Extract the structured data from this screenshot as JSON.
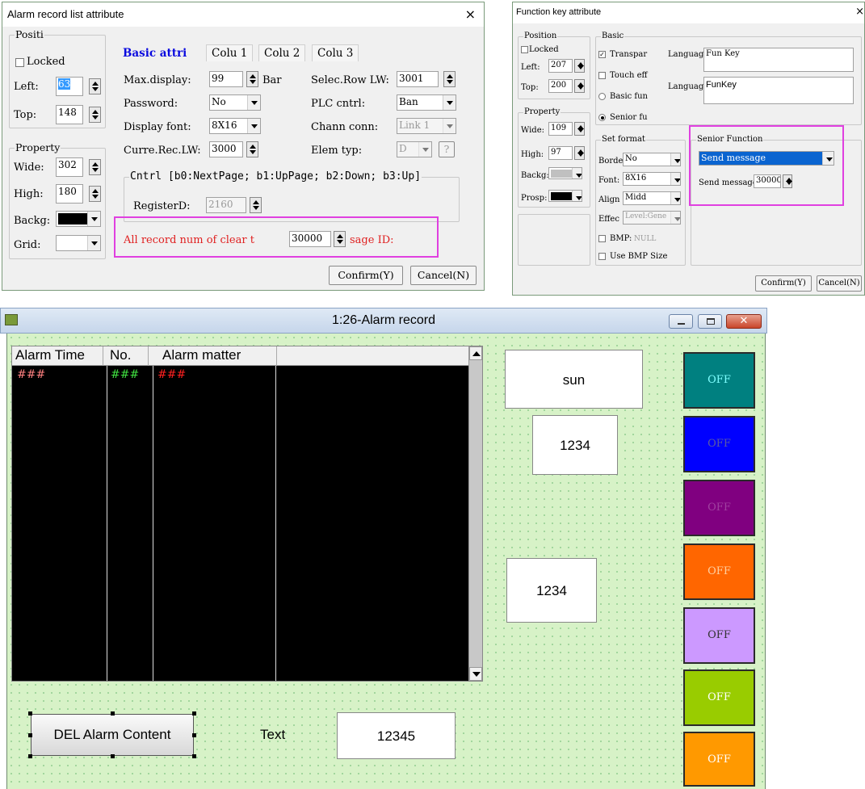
{
  "alarm_dialog": {
    "title": "Alarm record list attribute",
    "close": "×",
    "position": {
      "legend": "Positi",
      "locked": "Locked",
      "left_label": "Left:",
      "left_value": "63",
      "top_label": "Top:",
      "top_value": "148"
    },
    "property": {
      "legend": "Property",
      "wide_label": "Wide:",
      "wide_value": "302",
      "high_label": "High:",
      "high_value": "180",
      "backg_label": "Backg:",
      "backg_color": "#000000",
      "grid_label": "Grid:",
      "grid_color": "#ffffff"
    },
    "tabs": [
      "Basic attri",
      "Colu 1",
      "Colu 2",
      "Colu 3"
    ],
    "fields": {
      "max_display_label": "Max.display:",
      "max_display_value": "99",
      "bar_label": "Bar",
      "password_label": "Password:",
      "password_value": "No",
      "display_font_label": "Display font:",
      "display_font_value": "8X16",
      "curre_rec_label": "Curre.Rec.LW:",
      "curre_rec_value": "3000",
      "selec_row_label": "Selec.Row LW:",
      "selec_row_value": "3001",
      "plc_cntrl_label": "PLC cntrl:",
      "plc_cntrl_value": "Ban",
      "chann_conn_label": "Chann conn:",
      "chann_conn_value": "Link 1",
      "elem_typ_label": "Elem typ:",
      "elem_typ_value": "D",
      "elem_typ_btn": "?"
    },
    "cntrl": {
      "legend": "Cntrl [b0:NextPage; b1:UpPage; b2:Down; b3:Up]",
      "register_label": "RegisterD:",
      "register_value": "2160"
    },
    "clear": {
      "label_pre": "All record num of clear t",
      "value": "30000",
      "label_post": "sage ID:"
    },
    "confirm": "Confirm(Y)",
    "cancel": "Cancel(N)"
  },
  "func_dialog": {
    "title": "Function key attribute",
    "close": "×",
    "position": {
      "legend": "Position",
      "locked": "Locked",
      "left_label": "Left:",
      "left_value": "207",
      "top_label": "Top:",
      "top_value": "200"
    },
    "property": {
      "legend": "Property",
      "wide_label": "Wide:",
      "wide_value": "109",
      "high_label": "High:",
      "high_value": "97",
      "backg_label": "Backg:",
      "backg_color": "#c0c0c0",
      "prosp_label": "Prosp:",
      "prosp_color": "#000000"
    },
    "basic": {
      "legend": "Basic",
      "transpar": "Transpar",
      "touch_eff": "Touch eff",
      "basic_fun": "Basic fun",
      "senior_fun": "Senior fu",
      "language_label": "Languag",
      "language1_value": "Fun Key",
      "language2_label": "Languag",
      "language2_value": "FunKey"
    },
    "format": {
      "legend": "Set format",
      "border_label": "Borde",
      "border_value": "No",
      "font_label": "Font:",
      "font_value": "8X16",
      "align_label": "Align",
      "align_value": "Midd",
      "effect_label": "Effec",
      "effect_value": "Level:Gene",
      "bmp_label": "BMP:",
      "bmp_value": "NULL",
      "use_bmp": "Use BMP Size"
    },
    "senior": {
      "legend": "Senior Function",
      "selected": "Send message",
      "msg_label": "Send message",
      "msg_value": "30000"
    },
    "confirm": "Confirm(Y)",
    "cancel": "Cancel(N)"
  },
  "preview": {
    "title": "1:26-Alarm record",
    "table_headers": [
      "Alarm Time",
      "No.",
      "Alarm matter"
    ],
    "row": [
      "###",
      "###",
      "###"
    ],
    "boxes": {
      "sun": "sun",
      "num1": "1234",
      "num2": "1234",
      "num3": "12345"
    },
    "text_label": "Text",
    "del_button": "DEL Alarm Content",
    "tiles": [
      {
        "label": "OFF",
        "color": "#008080"
      },
      {
        "label": "OFF",
        "color": "#0000ff"
      },
      {
        "label": "OFF",
        "color": "#800080"
      },
      {
        "label": "OFF",
        "color": "#ff6600"
      },
      {
        "label": "OFF",
        "color": "#cc99ff"
      },
      {
        "label": "OFF",
        "color": "#99cc00"
      },
      {
        "label": "OFF",
        "color": "#ff9900"
      }
    ]
  }
}
